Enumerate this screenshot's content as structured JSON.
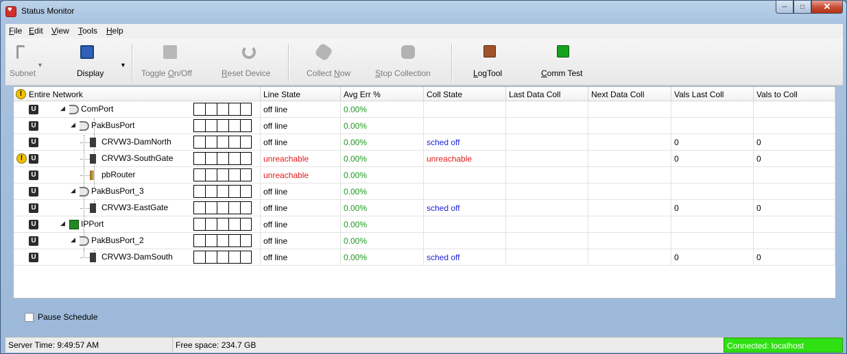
{
  "window": {
    "title": "Status Monitor"
  },
  "menu": [
    {
      "pre": "",
      "u": "F",
      "post": "ile"
    },
    {
      "pre": "",
      "u": "E",
      "post": "dit"
    },
    {
      "pre": "",
      "u": "V",
      "post": "iew"
    },
    {
      "pre": "",
      "u": "T",
      "post": "ools"
    },
    {
      "pre": "",
      "u": "H",
      "post": "elp"
    }
  ],
  "toolbar": {
    "subnet": "Subnet",
    "display": "Display",
    "toggle_pre": "Toggle ",
    "toggle_u": "O",
    "toggle_post": "n/Off",
    "reset_u": "R",
    "reset_post": "eset Device",
    "collect_pre": "Collect ",
    "collect_u": "N",
    "collect_post": "ow",
    "stop_u": "S",
    "stop_post": "top Collection",
    "logtool_u": "L",
    "logtool_post": "ogTool",
    "commtest_u": "C",
    "commtest_post": "omm Test"
  },
  "columns": [
    "Entire Network",
    "Line State",
    "Avg Err %",
    "Coll State",
    "Last Data Coll",
    "Next Data Coll",
    "Vals Last Coll",
    "Vals to Coll"
  ],
  "rows": [
    {
      "name": "ComPort",
      "line": "off line",
      "err": "0.00%",
      "coll": "",
      "vals_last": "",
      "vals_to": ""
    },
    {
      "name": "PakBusPort",
      "line": "off line",
      "err": "0.00%",
      "coll": "",
      "vals_last": "",
      "vals_to": ""
    },
    {
      "name": "CRVW3-DamNorth",
      "line": "off line",
      "err": "0.00%",
      "coll": "sched off",
      "vals_last": "0",
      "vals_to": "0"
    },
    {
      "name": "CRVW3-SouthGate",
      "line": "unreachable",
      "err": "0.00%",
      "coll": "unreachable",
      "vals_last": "0",
      "vals_to": "0"
    },
    {
      "name": "pbRouter",
      "line": "unreachable",
      "err": "0.00%",
      "coll": "",
      "vals_last": "",
      "vals_to": ""
    },
    {
      "name": "PakBusPort_3",
      "line": "off line",
      "err": "0.00%",
      "coll": "",
      "vals_last": "",
      "vals_to": ""
    },
    {
      "name": "CRVW3-EastGate",
      "line": "off line",
      "err": "0.00%",
      "coll": "sched off",
      "vals_last": "0",
      "vals_to": "0"
    },
    {
      "name": "IPPort",
      "line": "off line",
      "err": "0.00%",
      "coll": "",
      "vals_last": "",
      "vals_to": ""
    },
    {
      "name": "PakBusPort_2",
      "line": "off line",
      "err": "0.00%",
      "coll": "",
      "vals_last": "",
      "vals_to": ""
    },
    {
      "name": "CRVW3-DamSouth",
      "line": "off line",
      "err": "0.00%",
      "coll": "sched off",
      "vals_last": "0",
      "vals_to": "0"
    }
  ],
  "pause_schedule": "Pause Schedule",
  "status": {
    "server_time": "Server Time: 9:49:57 AM",
    "free_space": "Free space: 234.7 GB",
    "connection": "Connected: localhost"
  },
  "colors": {
    "ok": "#1c9a1c",
    "error": "#e01b1b",
    "info": "#1c23d9",
    "connected": "#2fe012"
  }
}
